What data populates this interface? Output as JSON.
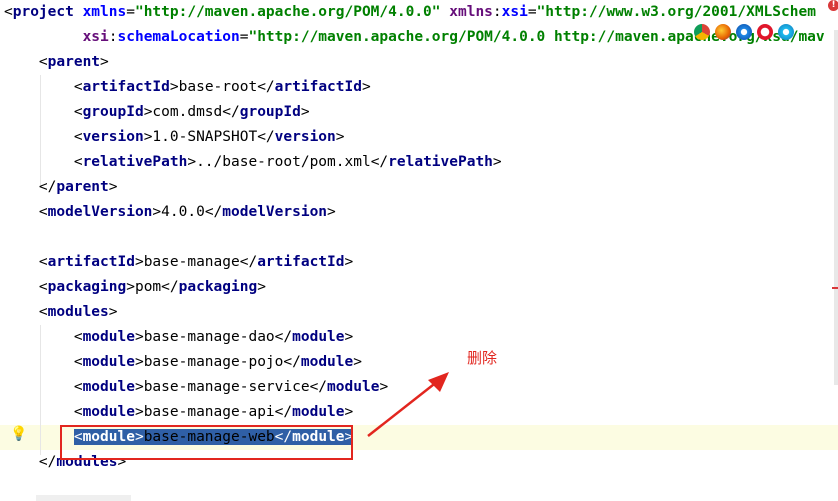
{
  "editor": {
    "lines": [
      {
        "segments": [
          [
            "br",
            "<"
          ],
          [
            "tn",
            "project"
          ],
          [
            "txt",
            " "
          ],
          [
            "an",
            "xmlns"
          ],
          [
            "br",
            "="
          ],
          [
            "av",
            "\"http://maven.apache.org/POM/4.0.0\""
          ],
          [
            "txt",
            " "
          ],
          [
            "ans",
            "xmlns"
          ],
          [
            "br",
            ":"
          ],
          [
            "an",
            "xsi"
          ],
          [
            "br",
            "="
          ],
          [
            "av",
            "\"http://www.w3.org/2001/XMLSchem"
          ]
        ]
      },
      {
        "segments": [
          [
            "txt",
            "         "
          ],
          [
            "ans",
            "xsi"
          ],
          [
            "br",
            ":"
          ],
          [
            "an",
            "schemaLocation"
          ],
          [
            "br",
            "="
          ],
          [
            "av",
            "\"http://maven.apache.org/POM/4.0.0 http://maven.apache.org/xsd/mav"
          ]
        ]
      },
      {
        "segments": [
          [
            "txt",
            "    "
          ],
          [
            "br",
            "<"
          ],
          [
            "tn",
            "parent"
          ],
          [
            "br",
            ">"
          ]
        ]
      },
      {
        "segments": [
          [
            "txt",
            "        "
          ],
          [
            "br",
            "<"
          ],
          [
            "tn",
            "artifactId"
          ],
          [
            "br",
            ">"
          ],
          [
            "txt",
            "base-root"
          ],
          [
            "br",
            "</"
          ],
          [
            "tn",
            "artifactId"
          ],
          [
            "br",
            ">"
          ]
        ]
      },
      {
        "segments": [
          [
            "txt",
            "        "
          ],
          [
            "br",
            "<"
          ],
          [
            "tn",
            "groupId"
          ],
          [
            "br",
            ">"
          ],
          [
            "txt",
            "com.dmsd"
          ],
          [
            "br",
            "</"
          ],
          [
            "tn",
            "groupId"
          ],
          [
            "br",
            ">"
          ]
        ]
      },
      {
        "segments": [
          [
            "txt",
            "        "
          ],
          [
            "br",
            "<"
          ],
          [
            "tn",
            "version"
          ],
          [
            "br",
            ">"
          ],
          [
            "txt",
            "1.0-SNAPSHOT"
          ],
          [
            "br",
            "</"
          ],
          [
            "tn",
            "version"
          ],
          [
            "br",
            ">"
          ]
        ]
      },
      {
        "segments": [
          [
            "txt",
            "        "
          ],
          [
            "br",
            "<"
          ],
          [
            "tn",
            "relativePath"
          ],
          [
            "br",
            ">"
          ],
          [
            "txt",
            "../base-root/pom.xml"
          ],
          [
            "br",
            "</"
          ],
          [
            "tn",
            "relativePath"
          ],
          [
            "br",
            ">"
          ]
        ]
      },
      {
        "segments": [
          [
            "txt",
            "    "
          ],
          [
            "br",
            "</"
          ],
          [
            "tn",
            "parent"
          ],
          [
            "br",
            ">"
          ]
        ]
      },
      {
        "segments": [
          [
            "txt",
            "    "
          ],
          [
            "br",
            "<"
          ],
          [
            "tn",
            "modelVersion"
          ],
          [
            "br",
            ">"
          ],
          [
            "txt",
            "4.0.0"
          ],
          [
            "br",
            "</"
          ],
          [
            "tn",
            "modelVersion"
          ],
          [
            "br",
            ">"
          ]
        ]
      },
      {
        "segments": []
      },
      {
        "segments": [
          [
            "txt",
            "    "
          ],
          [
            "br",
            "<"
          ],
          [
            "tn",
            "artifactId"
          ],
          [
            "br",
            ">"
          ],
          [
            "txt",
            "base-manage"
          ],
          [
            "br",
            "</"
          ],
          [
            "tn",
            "artifactId"
          ],
          [
            "br",
            ">"
          ]
        ]
      },
      {
        "segments": [
          [
            "txt",
            "    "
          ],
          [
            "br",
            "<"
          ],
          [
            "tn",
            "packaging"
          ],
          [
            "br",
            ">"
          ],
          [
            "txt",
            "pom"
          ],
          [
            "br",
            "</"
          ],
          [
            "tn",
            "packaging"
          ],
          [
            "br",
            ">"
          ]
        ]
      },
      {
        "segments": [
          [
            "txt",
            "    "
          ],
          [
            "br",
            "<"
          ],
          [
            "tn",
            "modules"
          ],
          [
            "br",
            ">"
          ]
        ]
      },
      {
        "segments": [
          [
            "txt",
            "        "
          ],
          [
            "br",
            "<"
          ],
          [
            "tn",
            "module"
          ],
          [
            "br",
            ">"
          ],
          [
            "txt",
            "base-manage-dao"
          ],
          [
            "br",
            "</"
          ],
          [
            "tn",
            "module"
          ],
          [
            "br",
            ">"
          ]
        ]
      },
      {
        "segments": [
          [
            "txt",
            "        "
          ],
          [
            "br",
            "<"
          ],
          [
            "tn",
            "module"
          ],
          [
            "br",
            ">"
          ],
          [
            "txt",
            "base-manage-pojo"
          ],
          [
            "br",
            "</"
          ],
          [
            "tn",
            "module"
          ],
          [
            "br",
            ">"
          ]
        ]
      },
      {
        "segments": [
          [
            "txt",
            "        "
          ],
          [
            "br",
            "<"
          ],
          [
            "tn",
            "module"
          ],
          [
            "br",
            ">"
          ],
          [
            "txt",
            "base-manage-service"
          ],
          [
            "br",
            "</"
          ],
          [
            "tn",
            "module"
          ],
          [
            "br",
            ">"
          ]
        ]
      },
      {
        "segments": [
          [
            "txt",
            "        "
          ],
          [
            "br",
            "<"
          ],
          [
            "tn",
            "module"
          ],
          [
            "br",
            ">"
          ],
          [
            "txt",
            "base-manage-api"
          ],
          [
            "br",
            "</"
          ],
          [
            "tn",
            "module"
          ],
          [
            "br",
            ">"
          ]
        ]
      },
      {
        "segments": [
          [
            "txt",
            "        "
          ],
          [
            "br",
            "<"
          ],
          [
            "tn",
            "module"
          ],
          [
            "br",
            ">"
          ],
          [
            "txt",
            "base-manage-web"
          ],
          [
            "br",
            "</"
          ],
          [
            "tn",
            "module"
          ],
          [
            "br",
            ">"
          ]
        ],
        "selected": true
      },
      {
        "segments": [
          [
            "txt",
            "    "
          ],
          [
            "br",
            "</"
          ],
          [
            "tn",
            "modules"
          ],
          [
            "br",
            ">"
          ]
        ]
      }
    ]
  },
  "annotation": {
    "label": "删除",
    "color": "#e2261f"
  },
  "browser_icons": [
    "chrome-icon",
    "firefox-icon",
    "safari-icon",
    "opera-icon",
    "ie-icon"
  ],
  "colors": {
    "tag": "#000080",
    "attr": "#0000ff",
    "value": "#008000",
    "selection": "#2f5fa6",
    "current_line": "#fcfce2"
  }
}
